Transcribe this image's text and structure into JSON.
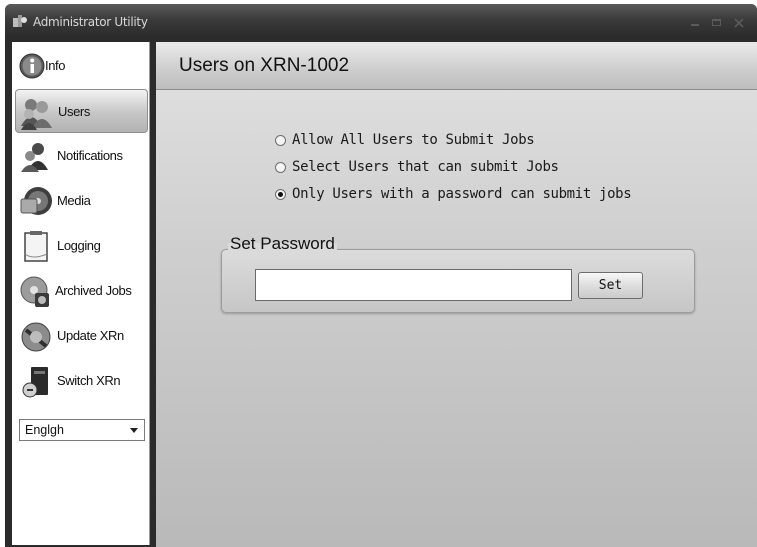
{
  "window": {
    "title": "Administrator Utility"
  },
  "sidebar": {
    "items": [
      {
        "label": "Info",
        "icon": "info-icon"
      },
      {
        "label": "Users",
        "icon": "users-icon",
        "active": true
      },
      {
        "label": "Notifications",
        "icon": "notifications-icon"
      },
      {
        "label": "Media",
        "icon": "media-icon"
      },
      {
        "label": "Logging",
        "icon": "logging-icon"
      },
      {
        "label": "Archived Jobs",
        "icon": "archived-jobs-icon"
      },
      {
        "label": "Update XRn",
        "icon": "update-icon"
      },
      {
        "label": "Switch XRn",
        "icon": "switch-icon"
      }
    ],
    "language": {
      "selected": "Englgh"
    }
  },
  "main": {
    "title": "Users on XRN-1002",
    "options": [
      {
        "label": "Allow All Users to Submit Jobs",
        "checked": false
      },
      {
        "label": "Select Users that can submit Jobs",
        "checked": false
      },
      {
        "label": "Only Users with a password can submit jobs",
        "checked": true
      }
    ],
    "password_group": {
      "legend": "Set Password",
      "input_value": "",
      "set_label": "Set"
    }
  }
}
